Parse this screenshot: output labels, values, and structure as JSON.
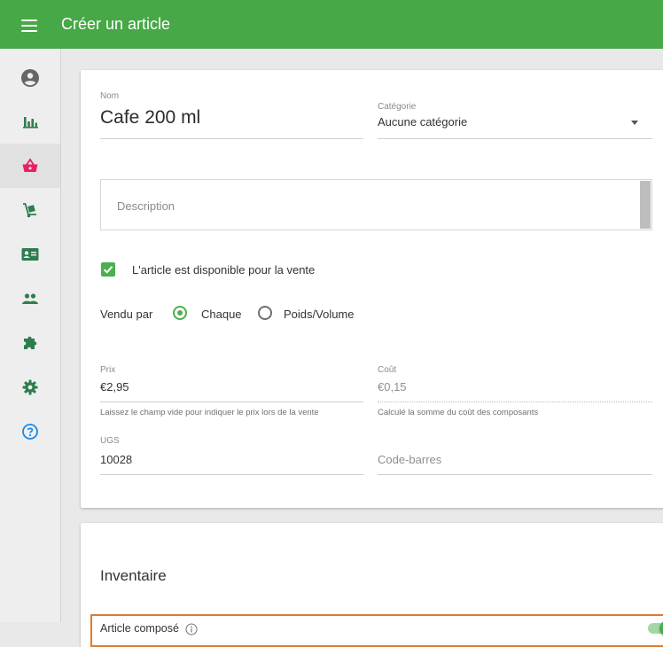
{
  "header": {
    "title": "Créer un article",
    "menu_icon": "hamburger-menu-icon"
  },
  "colors": {
    "brand": "#46a846",
    "accent": "#4caf50",
    "active_icon": "#e91e63",
    "icon": "#2e7d4f",
    "help_icon": "#1e88e5",
    "highlight": "#e07a2e"
  },
  "sidebar": {
    "items": [
      {
        "icon": "account-circle-icon"
      },
      {
        "icon": "bar-chart-icon"
      },
      {
        "icon": "shopping-basket-icon",
        "active": true
      },
      {
        "icon": "hand-truck-icon"
      },
      {
        "icon": "id-card-icon"
      },
      {
        "icon": "people-icon"
      },
      {
        "icon": "puzzle-piece-icon"
      },
      {
        "icon": "gear-icon"
      },
      {
        "icon": "help-circle-icon"
      }
    ]
  },
  "form": {
    "name": {
      "label": "Nom",
      "value": "Cafe 200 ml"
    },
    "category": {
      "label": "Catégorie",
      "value": "Aucune catégorie"
    },
    "description": {
      "placeholder": "Description"
    },
    "available": {
      "label": "L'article est disponible pour la vente",
      "checked": true
    },
    "sold_by": {
      "label": "Vendu par",
      "options": [
        {
          "label": "Chaque",
          "selected": true
        },
        {
          "label": "Poids/Volume",
          "selected": false
        }
      ]
    },
    "price": {
      "label": "Prix",
      "value": "€2,95",
      "help": "Laissez le champ vide pour indiquer le prix lors de la vente"
    },
    "cost": {
      "label": "Coût",
      "value": "€0,15",
      "help": "Calculé la somme du coût des composants"
    },
    "sku": {
      "label": "UGS",
      "value": "10028"
    },
    "barcode": {
      "placeholder": "Code-barres"
    }
  },
  "inventory": {
    "title": "Inventaire",
    "composite": {
      "label": "Article composé",
      "enabled": true
    }
  }
}
